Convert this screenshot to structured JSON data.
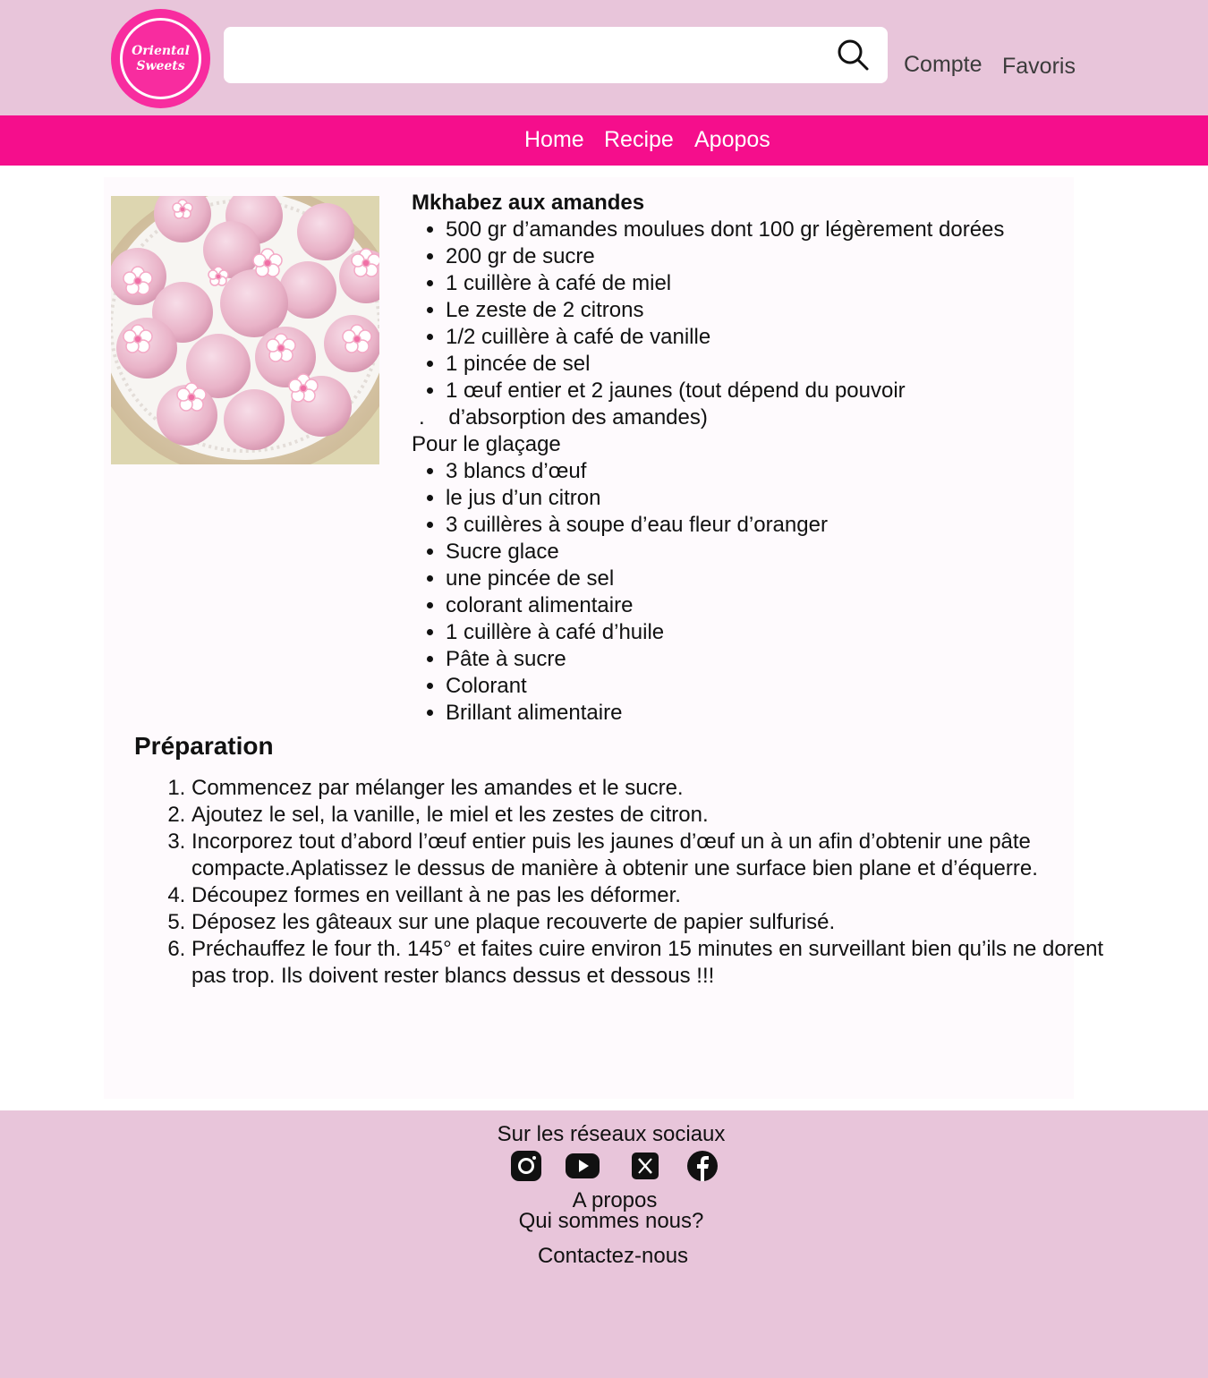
{
  "header": {
    "logo_line1": "Oriental",
    "logo_line2": "Sweets",
    "search_placeholder": "",
    "links": {
      "compte": "Compte",
      "favoris": "Favoris"
    }
  },
  "nav": {
    "home": "Home",
    "recipe": "Recipe",
    "apropos": "Apopos"
  },
  "recipe": {
    "title": "Mkhabez aux amandes",
    "ingredients": [
      "500 gr d’amandes moulues dont 100 gr légèrement dorées",
      "200 gr de sucre",
      "1 cuillère à café de miel",
      "Le zeste de 2 citrons",
      "1/2 cuillère à café de vanille",
      "1 pincée de sel",
      "1 œuf entier et 2 jaunes (tout dépend du pouvoir"
    ],
    "continuation": ".    d’absorption des amandes)",
    "glaze_heading": "Pour le glaçage",
    "glaze": [
      "3 blancs d’œuf",
      "le jus d’un citron",
      "3 cuillères à soupe d’eau fleur d’oranger",
      "Sucre glace",
      "une pincée de sel",
      "colorant alimentaire",
      "1 cuillère à café d’huile",
      "Pâte à sucre",
      "Colorant",
      "Brillant alimentaire"
    ],
    "prep_heading": "Préparation",
    "steps": [
      "Commencez par mélanger les amandes et le sucre.",
      "Ajoutez le sel, la vanille, le miel et les zestes de citron.",
      "Incorporez tout d’abord l’œuf entier puis les jaunes d’œuf un à un afin d’obtenir une pâte compacte.Aplatissez le dessus de manière à obtenir une surface bien plane et d’équerre.",
      "Découpez formes en veillant à ne pas les déformer.",
      "Déposez les gâteaux sur une plaque recouverte de papier sulfurisé.",
      "Préchauffez le four th. 145° et faites cuire environ 15 minutes en surveillant bien qu’ils ne dorent pas trop. Ils doivent rester blancs dessus et dessous !!!"
    ]
  },
  "footer": {
    "social_title": "Sur les réseaux sociaux",
    "social_icons": [
      "instagram-icon",
      "youtube-icon",
      "x-icon",
      "facebook-icon"
    ],
    "apropos": "A propos",
    "who": "Qui sommes nous?",
    "contact": "Contactez-nous"
  },
  "colors": {
    "header_bg": "#e8c5da",
    "nav_bg": "#f50e8c",
    "logo": "#f82c9f",
    "content_bg": "#fefafd"
  }
}
